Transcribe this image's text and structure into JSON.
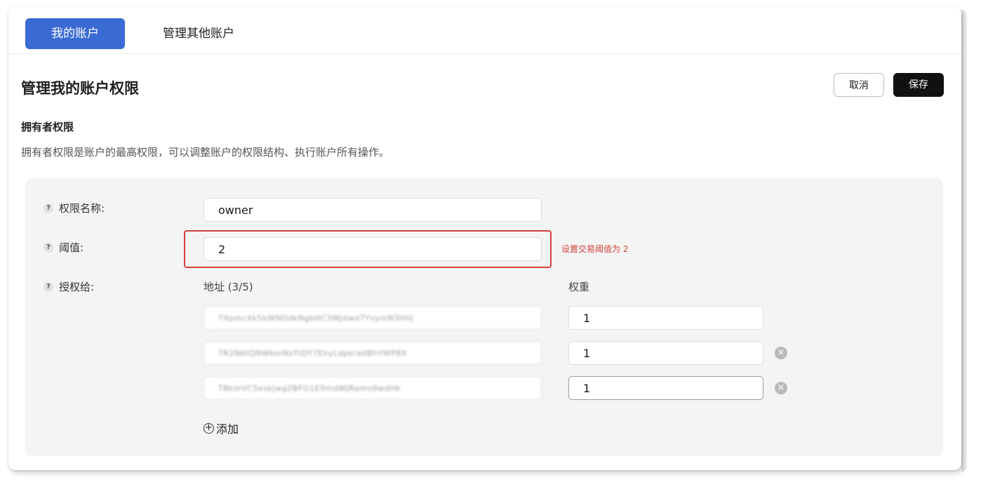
{
  "tabs": [
    {
      "label": "我的账户",
      "active": true
    },
    {
      "label": "管理其他账户",
      "active": false
    }
  ],
  "header": {
    "title": "管理我的账户权限",
    "cancel_label": "取消",
    "save_label": "保存"
  },
  "section": {
    "title": "拥有者权限",
    "description": "拥有者权限是账户的最高权限，可以调整账户的权限结构、执行账户所有操作。"
  },
  "form": {
    "help_glyph": "?",
    "name_label": "权限名称:",
    "name_value": "owner",
    "threshold_label": "阈值:",
    "threshold_value": "2",
    "threshold_annotation": "设置交易阈值为 2",
    "grant_label": "授权给:",
    "address_header": "地址 (3/5)",
    "weight_header": "权重",
    "keys": [
      {
        "address": "TXpmcXk5bWNDdkNgbHC3WJdwd7YvymN3HhJ",
        "weight": "1"
      },
      {
        "address": "TR2N6tQNWkorNzTtDY7EhyLdpkradBhYWP8X",
        "weight": "1"
      },
      {
        "address": "TBkmVC5eskJwgZBFG1E9mdWJRamo9wdHk",
        "weight": "1"
      }
    ],
    "remove_glyph": "×",
    "add_glyph": "+",
    "add_label": "添加"
  },
  "colors": {
    "tab_active": "#3a6ad4",
    "save_button": "#111111",
    "highlight": "#d0413b",
    "panel": "#f4f4f4"
  }
}
